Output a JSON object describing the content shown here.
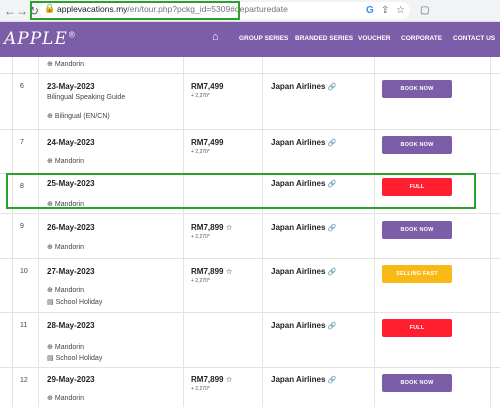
{
  "browser": {
    "url_main": "applevacations.my",
    "url_rest": "/en/tour.php?pckg_id=5309#departuredate"
  },
  "site": {
    "logo": "APPLE",
    "logo_mark": "®",
    "menu": [
      "GROUP SERIES",
      "BRANDED SERIES",
      "VOUCHER",
      "CORPORATE",
      "CONTACT US"
    ]
  },
  "rows": [
    {
      "num": "",
      "date": "",
      "note": "",
      "lang": "Mandorin",
      "tag": "",
      "price": "",
      "tax": "",
      "airline": "",
      "button": ""
    },
    {
      "num": "6",
      "date": "23-May-2023",
      "note": "Bilingual Speaking Guide",
      "lang": "Bilingual (EN/CN)",
      "tag": "",
      "price": "RM7,499",
      "tax": "+ 2,270*",
      "airline": "Japan Airlines",
      "button": "BOOK NOW"
    },
    {
      "num": "7",
      "date": "24-May-2023",
      "note": "",
      "lang": "Mandorin",
      "tag": "",
      "price": "RM7,499",
      "tax": "+ 2,270*",
      "airline": "Japan Airlines",
      "button": "BOOK NOW"
    },
    {
      "num": "8",
      "date": "25-May-2023",
      "note": "",
      "lang": "Mandorin",
      "tag": "",
      "price": "",
      "tax": "",
      "airline": "Japan Airlines",
      "button": "FULL"
    },
    {
      "num": "9",
      "date": "26-May-2023",
      "note": "",
      "lang": "Mandorin",
      "tag": "",
      "price": "RM7,899",
      "tax": "+ 2,270*",
      "airline": "Japan Airlines",
      "button": "BOOK NOW"
    },
    {
      "num": "10",
      "date": "27-May-2023",
      "note": "",
      "lang": "Mandorin",
      "tag": "School Holiday",
      "price": "RM7,899",
      "tax": "+ 2,270*",
      "airline": "Japan Airlines",
      "button": "SELLING FAST"
    },
    {
      "num": "11",
      "date": "28-May-2023",
      "note": "",
      "lang": "Mandorin",
      "tag": "School Holiday",
      "price": "",
      "tax": "",
      "airline": "Japan Airlines",
      "button": "FULL"
    },
    {
      "num": "12",
      "date": "29-May-2023",
      "note": "",
      "lang": "Mandorin",
      "tag": "",
      "price": "RM7,899",
      "tax": "+ 2,270*",
      "airline": "Japan Airlines",
      "button": "BOOK NOW"
    }
  ],
  "colors": {
    "brand_purple": "#7b5ea7",
    "full_red": "#ff1f2e",
    "selling_fast_yellow": "#f7b915",
    "highlight_green": "#2ca02c"
  },
  "icons": {
    "back": "back-arrow-icon",
    "forward": "forward-arrow-icon",
    "reload": "reload-icon",
    "home": "home-icon",
    "lock": "lock-icon",
    "globe": "globe-icon",
    "calendar": "calendar-icon",
    "link": "link-icon"
  }
}
